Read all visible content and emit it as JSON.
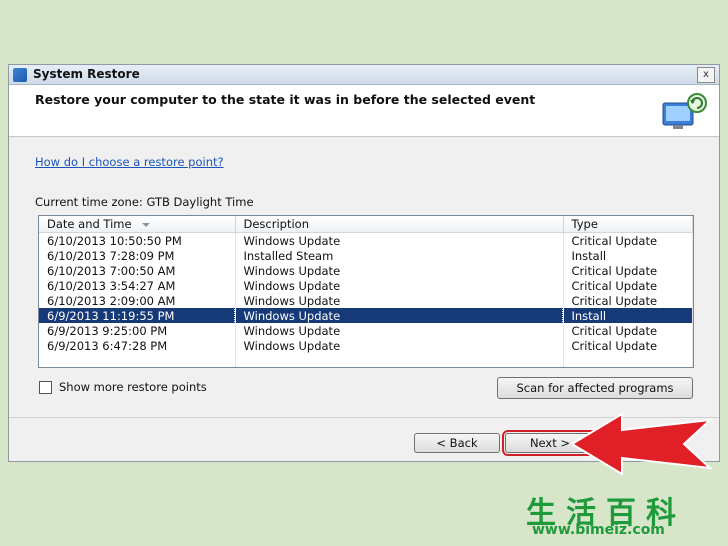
{
  "window": {
    "title": "System Restore",
    "close_glyph": "x"
  },
  "header": {
    "heading": "Restore your computer to the state it was in before the selected event"
  },
  "help_link": "How do I choose a restore point?",
  "timezone_label": "Current time zone: GTB Daylight Time",
  "table": {
    "columns": [
      "Date and Time",
      "Description",
      "Type"
    ],
    "rows": [
      [
        "6/10/2013 10:50:50 PM",
        "Windows Update",
        "Critical Update"
      ],
      [
        "6/10/2013 7:28:09 PM",
        "Installed Steam",
        "Install"
      ],
      [
        "6/10/2013 7:00:50 AM",
        "Windows Update",
        "Critical Update"
      ],
      [
        "6/10/2013 3:54:27 AM",
        "Windows Update",
        "Critical Update"
      ],
      [
        "6/10/2013 2:09:00 AM",
        "Windows Update",
        "Critical Update"
      ],
      [
        "6/9/2013 11:19:55 PM",
        "Windows Update",
        "Install"
      ],
      [
        "6/9/2013 9:25:00 PM",
        "Windows Update",
        "Critical Update"
      ],
      [
        "6/9/2013 6:47:28 PM",
        "Windows Update",
        "Critical Update"
      ]
    ],
    "selected_row": 5
  },
  "show_more_label": "Show more restore points",
  "scan_button": "Scan for affected programs",
  "back_button": "< Back",
  "next_button": "Next >",
  "watermark": {
    "chars": "生活百科",
    "url": "www.bimeiz.com"
  }
}
